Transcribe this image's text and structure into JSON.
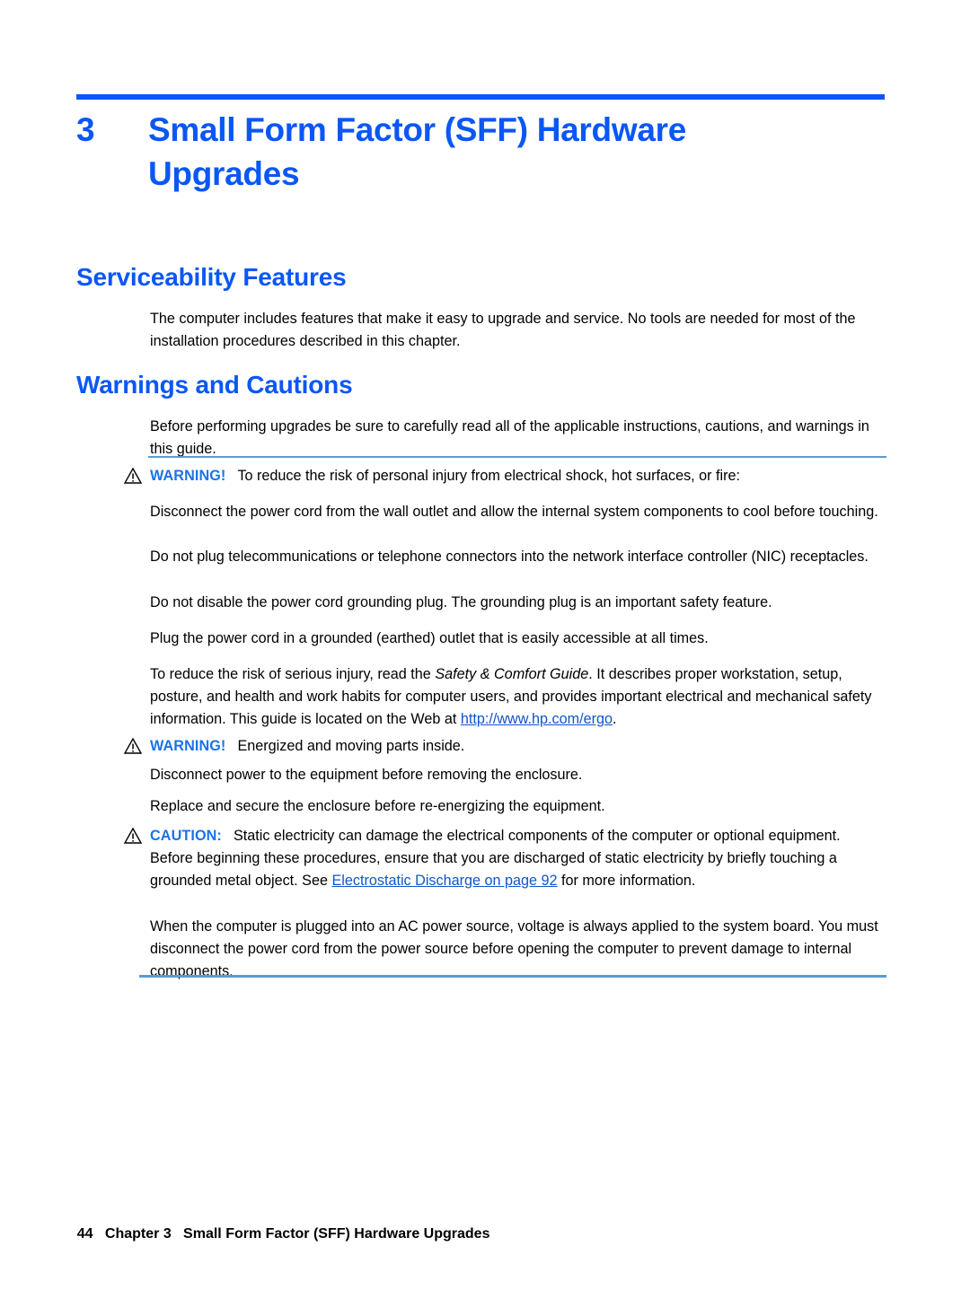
{
  "chapter": {
    "number": "3",
    "title": "Small Form Factor (SFF) Hardware Upgrades"
  },
  "sections": {
    "serviceability": {
      "heading": "Serviceability Features",
      "paragraph": "The computer includes features that make it easy to upgrade and service. No tools are needed for most of the installation procedures described in this chapter."
    },
    "warnings": {
      "heading": "Warnings and Cautions",
      "paragraph": "Before performing upgrades be sure to carefully read all of the applicable instructions, cautions, and warnings in this guide."
    }
  },
  "note_box": {
    "warning_1": {
      "icon": "warning-triangle-icon",
      "label": "WARNING!",
      "lead_text": "To reduce the risk of personal injury from electrical shock, hot surfaces, or fire:",
      "paragraphs": [
        "Disconnect the power cord from the wall outlet and allow the internal system components to cool before touching.",
        "Do not plug telecommunications or telephone connectors into the network interface controller (NIC) receptacles.",
        "Do not disable the power cord grounding plug. The grounding plug is an important safety feature.",
        "Plug the power cord in a grounded (earthed) outlet that is easily accessible at all times."
      ],
      "safety_guide_para": {
        "before_italic": "To reduce the risk of serious injury, read the ",
        "italic": "Safety & Comfort Guide",
        "after_italic": ". It describes proper workstation, setup, posture, and health and work habits for computer users, and provides important electrical and mechanical safety information. This guide is located on the Web at ",
        "link": "http://www.hp.com/ergo",
        "tail": "."
      }
    },
    "warning_2": {
      "icon": "warning-triangle-icon",
      "label": "WARNING!",
      "lead_text": "Energized and moving parts inside.",
      "paragraphs": [
        "Disconnect power to the equipment before removing the enclosure.",
        "Replace and secure the enclosure before re-energizing the equipment."
      ]
    },
    "caution": {
      "icon": "caution-triangle-icon",
      "label": "CAUTION:",
      "lead_before_link": "Static electricity can damage the electrical components of the computer or optional equipment. Before beginning these procedures, ensure that you are discharged of static electricity by briefly touching a grounded metal object. See ",
      "link": "Electrostatic Discharge on page 92",
      "lead_after_link": " for more information.",
      "closing_paragraph": "When the computer is plugged into an AC power source, voltage is always applied to the system board. You must disconnect the power cord from the power source before opening the computer to prevent damage to internal components."
    }
  },
  "footer": {
    "page_number": "44",
    "text": "Chapter 3   Small Form Factor (SFF) Hardware Upgrades"
  },
  "colors": {
    "heading_blue": "#0a57f5",
    "label_blue": "#1a73e8",
    "rule_blue": "#5b9bd5",
    "link_blue": "#1155cc"
  }
}
